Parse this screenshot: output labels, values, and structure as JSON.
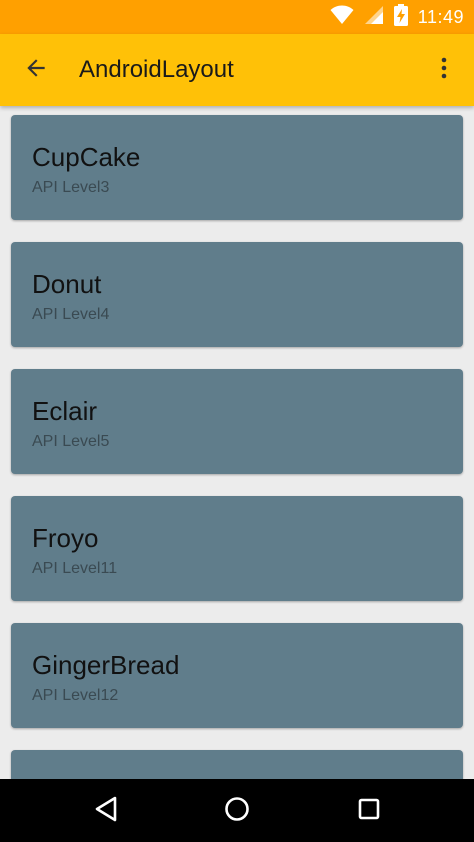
{
  "status_bar": {
    "time": "11:49",
    "icons": [
      "wifi-icon",
      "cell-signal-icon",
      "battery-charging-icon"
    ],
    "color": "#FFA000"
  },
  "app_bar": {
    "title": "AndroidLayout",
    "back_icon": "arrow-back-icon",
    "overflow_icon": "more-vert-icon",
    "color": "#FFC107"
  },
  "cards": [
    {
      "title": "CupCake",
      "subtitle": "API Level3"
    },
    {
      "title": "Donut",
      "subtitle": "API Level4"
    },
    {
      "title": "Eclair",
      "subtitle": "API Level5"
    },
    {
      "title": "Froyo",
      "subtitle": "API Level11"
    },
    {
      "title": "GingerBread",
      "subtitle": "API Level12"
    }
  ],
  "card_color": "#607D8B",
  "nav_bar": {
    "icons": [
      "back-triangle-icon",
      "home-circle-icon",
      "recents-square-icon"
    ]
  }
}
